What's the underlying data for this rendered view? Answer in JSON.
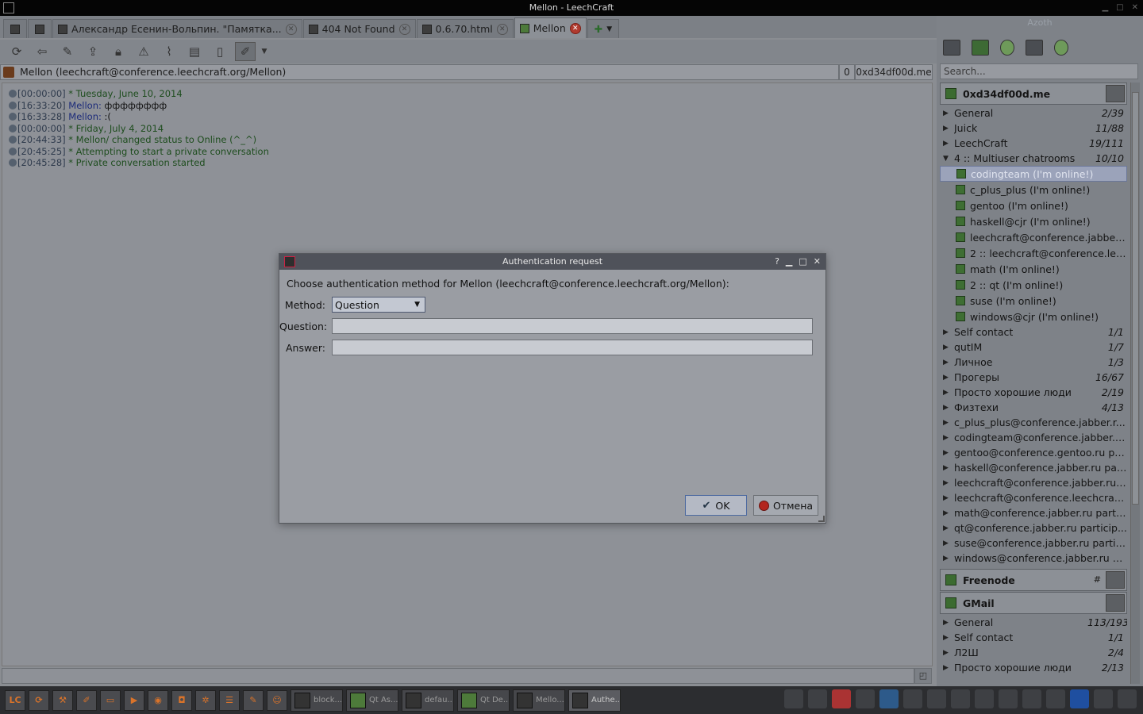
{
  "window": {
    "title": "Mellon - LeechCraft"
  },
  "tabs": [
    {
      "label": ""
    },
    {
      "label": ""
    },
    {
      "label": "Александр Есенин-Вольпин. \"Памятка..."
    },
    {
      "label": "404 Not Found"
    },
    {
      "label": "0.6.70.html"
    },
    {
      "label": "Mellon"
    }
  ],
  "chat": {
    "entity": "Mellon (leechcraft@conference.leechcraft.org/Mellon)",
    "count": "0",
    "account": "0xd34df00d.me",
    "messages": [
      {
        "ts": "[00:00:00]",
        "nick": "",
        "text": "* Tuesday, June 10, 2014",
        "kind": "sys"
      },
      {
        "ts": "[16:33:20]",
        "nick": "Mellon:",
        "text": "фффффффф",
        "kind": "msg"
      },
      {
        "ts": "[16:33:28]",
        "nick": "Mellon:",
        "text": ":(",
        "kind": "msg"
      },
      {
        "ts": "[00:00:00]",
        "nick": "",
        "text": "* Friday, July 4, 2014",
        "kind": "sys"
      },
      {
        "ts": "[20:44:33]",
        "nick": "",
        "text": "* Mellon/ changed status to Online (^_^)",
        "kind": "sys"
      },
      {
        "ts": "[20:45:25]",
        "nick": "",
        "text": "* Attempting to start a private conversation",
        "kind": "sys"
      },
      {
        "ts": "[20:45:28]",
        "nick": "",
        "text": "* Private conversation started",
        "kind": "sys"
      }
    ]
  },
  "panel": {
    "title": "Azoth",
    "search_placeholder": "Search...",
    "accounts": [
      {
        "name": "0xd34df00d.me",
        "groups": [
          {
            "name": "General",
            "count": "2/39",
            "expanded": false
          },
          {
            "name": "Juick",
            "count": "11/88",
            "expanded": false
          },
          {
            "name": "LeechCraft",
            "count": "19/111",
            "expanded": false
          },
          {
            "name": "4 :: Multiuser chatrooms",
            "count": "10/10",
            "expanded": true
          }
        ],
        "contacts": [
          "codingteam (I'm online!)",
          "c_plus_plus (I'm online!)",
          "gentoo (I'm online!)",
          "haskell@cjr (I'm online!)",
          "leechcraft@conference.jabber.r...",
          "2 :: leechcraft@conference.lee...",
          "math (I'm online!)",
          "2 :: qt (I'm online!)",
          "suse (I'm online!)",
          "windows@cjr (I'm online!)"
        ],
        "groups_after": [
          {
            "name": "Self contact",
            "count": "1/1"
          },
          {
            "name": "qutIM",
            "count": "1/7"
          },
          {
            "name": "Личное",
            "count": "1/3"
          },
          {
            "name": "Прогеры",
            "count": "16/67"
          },
          {
            "name": "Просто хорошие люди",
            "count": "2/19"
          },
          {
            "name": "Физтехи",
            "count": "4/13"
          },
          {
            "name": "c_plus_plus@conference.jabber.r...",
            "count": ""
          },
          {
            "name": "codingteam@conference.jabber.r...",
            "count": ""
          },
          {
            "name": "gentoo@conference.gentoo.ru pa...",
            "count": ""
          },
          {
            "name": "haskell@conference.jabber.ru par...",
            "count": ""
          },
          {
            "name": "leechcraft@conference.jabber.ru ...",
            "count": ""
          },
          {
            "name": "leechcraft@conference.leechcraft...",
            "count": ""
          },
          {
            "name": "math@conference.jabber.ru parti...",
            "count": ""
          },
          {
            "name": "qt@conference.jabber.ru particip...",
            "count": ""
          },
          {
            "name": "suse@conference.jabber.ru partic...",
            "count": ""
          },
          {
            "name": "windows@conference.jabber.ru p...",
            "count": ""
          }
        ]
      },
      {
        "name": "Freenode",
        "extra": "#"
      },
      {
        "name": "GMail",
        "groups": [
          {
            "name": "General",
            "count": "113/193"
          },
          {
            "name": "Self contact",
            "count": "1/1"
          },
          {
            "name": "Л2Ш",
            "count": "2/4"
          },
          {
            "name": "Просто хорошие люди",
            "count": "2/13"
          }
        ]
      }
    ]
  },
  "taskbar": {
    "tasks": [
      "block...",
      "Qt As...",
      "defau...",
      "Qt De...",
      "Mello...",
      "Authe..."
    ]
  },
  "dialog": {
    "title": "Authentication request",
    "prompt": "Choose authentication method for Mellon (leechcraft@conference.leechcraft.org/Mellon):",
    "method_label": "Method:",
    "method_value": "Question",
    "question_label": "Question:",
    "question_value": "",
    "answer_label": "Answer:",
    "answer_value": "",
    "ok_label": "OK",
    "cancel_label": "Отмена"
  }
}
